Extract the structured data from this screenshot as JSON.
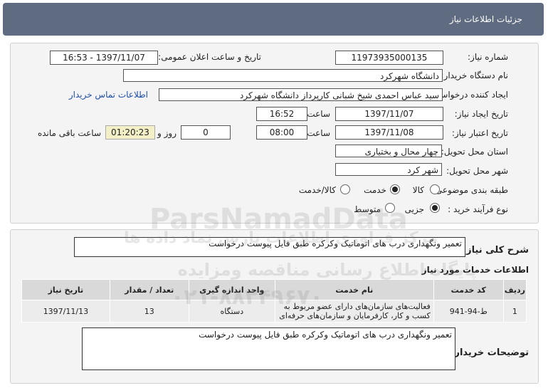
{
  "header": {
    "title": "جزئیات اطلاعات نیاز"
  },
  "form": {
    "need_number_label": "شماره نیاز:",
    "need_number": "11973935000135",
    "announce_label": "تاریخ و ساعت اعلان عمومی:",
    "announce_value": "1397/11/07 - 16:53",
    "buyer_org_label": "نام دستگاه خریدار:",
    "buyer_org": "دانشگاه شهرکرد",
    "creator_label": "ایجاد کننده درخواست:",
    "creator": "سید عباس احمدی شیخ شبانی کارپرداز دانشگاه شهرکرد",
    "contact_link": "اطلاعات تماس خریدار",
    "create_date_label": "تاریخ ایجاد نیاز:",
    "create_date": "1397/11/07",
    "time_label": "ساعت",
    "create_time": "16:52",
    "validity_label": "تاریخ اعتبار نیاز:",
    "validity_date": "1397/11/08",
    "validity_time": "08:00",
    "days_value": "0",
    "days_label": "روز و",
    "remaining_time": "01:20:23",
    "remaining_label": "ساعت باقی مانده",
    "province_label": "استان محل تحویل:",
    "province": "چهار محال و بختیاری",
    "city_label": "شهر محل تحویل:",
    "city": "شهر کرد",
    "category_label": "طبقه بندی موضوعی:",
    "category_options": [
      "کالا",
      "خدمت",
      "کالا/خدمت"
    ],
    "category_selected": "خدمت",
    "process_label": "نوع فرآیند خرید :",
    "process_options": [
      "جزیی",
      "متوسط"
    ],
    "process_selected": "جزیی"
  },
  "summary": {
    "label": "شرح کلی نیاز:",
    "text": "تعمیر ونگهداری درب های اتوماتیک وکرکره طبق فایل پیوست درخواست"
  },
  "services": {
    "title": "اطلاعات خدمات مورد نیاز",
    "columns": [
      "ردیف",
      "کد خدمت",
      "نام خدمت",
      "واحد اندازه گیری",
      "تعداد / مقدار",
      "تاریخ نیاز"
    ],
    "rows": [
      [
        "1",
        "ط-94-941",
        "فعالیت‌های سازمان‌های دارای عضو مربوط به کسب و کار، کارفرمایان و سازمان‌های حرفه‌ای",
        "دستگاه",
        "13",
        "1397/11/13"
      ]
    ]
  },
  "buyer_notes": {
    "label": "توضیحات خریدار:",
    "text": "تعمیر ونگهداری درب های اتوماتیک وکرکره طبق فایل پیوست درخواست"
  },
  "watermark": {
    "brand": "ParsNamadData",
    "line1": "مرکز فراوری اطلاعات پارس نماد داده ها",
    "line2": "پایگاه اطلاع رسانی مناقصه ومزایده",
    "phone": "۰۲۱-۸۸۳۴۹۶۷۰"
  }
}
